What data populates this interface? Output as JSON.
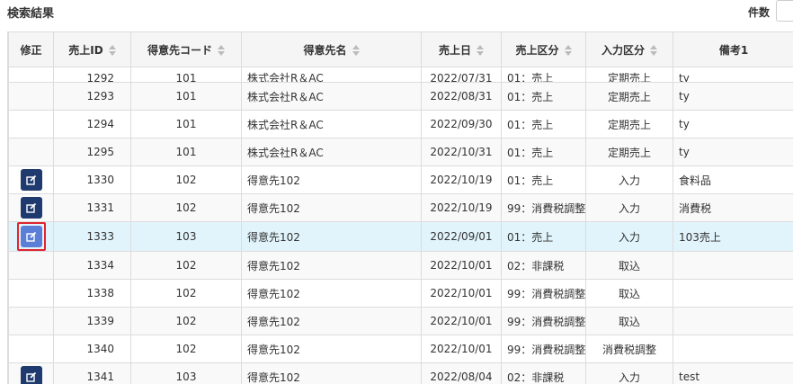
{
  "header": {
    "title": "検索結果",
    "count_label": "件数"
  },
  "columns": [
    {
      "key": "edit",
      "label": "修正",
      "sortable": false
    },
    {
      "key": "id",
      "label": "売上ID",
      "sortable": true
    },
    {
      "key": "cust_code",
      "label": "得意先コード",
      "sortable": true
    },
    {
      "key": "cust_name",
      "label": "得意先名",
      "sortable": true
    },
    {
      "key": "date",
      "label": "売上日",
      "sortable": true
    },
    {
      "key": "sales_type",
      "label": "売上区分",
      "sortable": true
    },
    {
      "key": "input_type",
      "label": "入力区分",
      "sortable": true
    },
    {
      "key": "note",
      "label": "備考1",
      "sortable": false
    }
  ],
  "rows": [
    {
      "id": "1292",
      "cust_code": "101",
      "cust_name": "株式会社R＆AC",
      "date": "2022/07/31",
      "sales_type": "01：売上",
      "input_type": "定期売上",
      "note": "ty",
      "edit": false
    },
    {
      "id": "1293",
      "cust_code": "101",
      "cust_name": "株式会社R＆AC",
      "date": "2022/08/31",
      "sales_type": "01：売上",
      "input_type": "定期売上",
      "note": "ty",
      "edit": false
    },
    {
      "id": "1294",
      "cust_code": "101",
      "cust_name": "株式会社R＆AC",
      "date": "2022/09/30",
      "sales_type": "01：売上",
      "input_type": "定期売上",
      "note": "ty",
      "edit": false
    },
    {
      "id": "1295",
      "cust_code": "101",
      "cust_name": "株式会社R＆AC",
      "date": "2022/10/31",
      "sales_type": "01：売上",
      "input_type": "定期売上",
      "note": "ty",
      "edit": false
    },
    {
      "id": "1330",
      "cust_code": "102",
      "cust_name": "得意先102",
      "date": "2022/10/19",
      "sales_type": "01：売上",
      "input_type": "入力",
      "note": "食料品",
      "edit": true
    },
    {
      "id": "1331",
      "cust_code": "102",
      "cust_name": "得意先102",
      "date": "2022/10/19",
      "sales_type": "99：消費税調整",
      "input_type": "入力",
      "note": "消費税",
      "edit": true
    },
    {
      "id": "1333",
      "cust_code": "103",
      "cust_name": "得意先102",
      "date": "2022/09/01",
      "sales_type": "01：売上",
      "input_type": "入力",
      "note": "103売上",
      "edit": true,
      "selected": true
    },
    {
      "id": "1334",
      "cust_code": "102",
      "cust_name": "得意先102",
      "date": "2022/10/01",
      "sales_type": "02：非課税",
      "input_type": "取込",
      "note": "",
      "edit": false
    },
    {
      "id": "1338",
      "cust_code": "102",
      "cust_name": "得意先102",
      "date": "2022/10/01",
      "sales_type": "99：消費税調整",
      "input_type": "取込",
      "note": "",
      "edit": false
    },
    {
      "id": "1339",
      "cust_code": "102",
      "cust_name": "得意先102",
      "date": "2022/10/01",
      "sales_type": "99：消費税調整",
      "input_type": "取込",
      "note": "",
      "edit": false
    },
    {
      "id": "1340",
      "cust_code": "102",
      "cust_name": "得意先102",
      "date": "2022/10/01",
      "sales_type": "99：消費税調整",
      "input_type": "消費税調整",
      "note": "",
      "edit": false
    },
    {
      "id": "1341",
      "cust_code": "103",
      "cust_name": "得意先102",
      "date": "2022/08/04",
      "sales_type": "02：非課税",
      "input_type": "入力",
      "note": "test",
      "edit": true
    }
  ]
}
